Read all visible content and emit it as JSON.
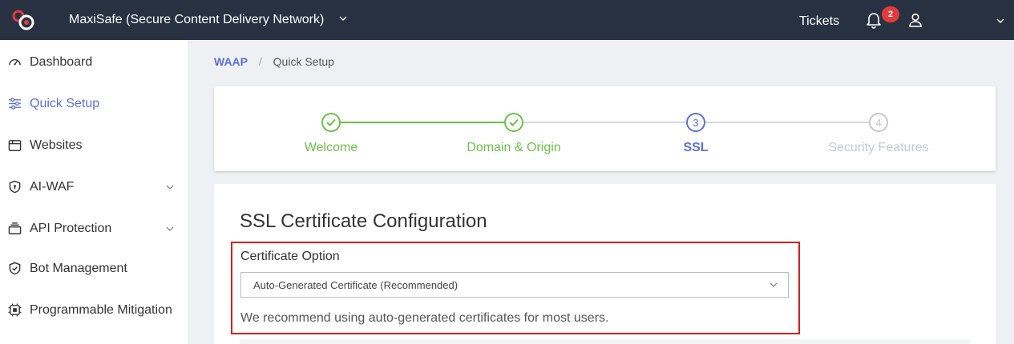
{
  "header": {
    "app_title": "MaxiSafe (Secure Content Delivery Network)",
    "tickets_label": "Tickets",
    "notification_count": "2",
    "colors": {
      "bar": "#283142",
      "badge": "#e23b3b",
      "logo": "#e23b3b"
    },
    "icons": [
      "logo-icon",
      "chevron-down-icon",
      "bell-icon",
      "user-icon"
    ]
  },
  "sidebar": {
    "items": [
      {
        "label": "Dashboard",
        "icon": "gauge-icon",
        "active": false,
        "expandable": false
      },
      {
        "label": "Quick Setup",
        "icon": "sliders-icon",
        "active": true,
        "expandable": false
      },
      {
        "label": "Websites",
        "icon": "browser-window-icon",
        "active": false,
        "expandable": false
      },
      {
        "label": "AI-WAF",
        "icon": "shield-icon",
        "active": false,
        "expandable": true
      },
      {
        "label": "API Protection",
        "icon": "stack-icon",
        "active": false,
        "expandable": true
      },
      {
        "label": "Bot Management",
        "icon": "shield-check-icon",
        "active": false,
        "expandable": false
      },
      {
        "label": "Programmable Mitigation",
        "icon": "chip-icon",
        "active": false,
        "expandable": false
      }
    ],
    "accent_color": "#5b6fd6"
  },
  "breadcrumb": {
    "root": "WAAP",
    "separator": "/",
    "current": "Quick Setup"
  },
  "wizard": {
    "steps": [
      {
        "number": "1",
        "label": "Welcome",
        "status": "completed"
      },
      {
        "number": "2",
        "label": "Domain & Origin",
        "status": "completed"
      },
      {
        "number": "3",
        "label": "SSL",
        "status": "current"
      },
      {
        "number": "4",
        "label": "Security Features",
        "status": "pending"
      }
    ],
    "colors": {
      "completed": "#6cc04a",
      "current": "#5b6fd6",
      "pending": "#c5c8ce"
    }
  },
  "ssl_config": {
    "title": "SSL Certificate Configuration",
    "certificate_option_label": "Certificate Option",
    "selected_option": "Auto-Generated Certificate (Recommended)",
    "help_text": "We recommend using auto-generated certificates for most users.",
    "highlight_color": "#d61f1f"
  }
}
